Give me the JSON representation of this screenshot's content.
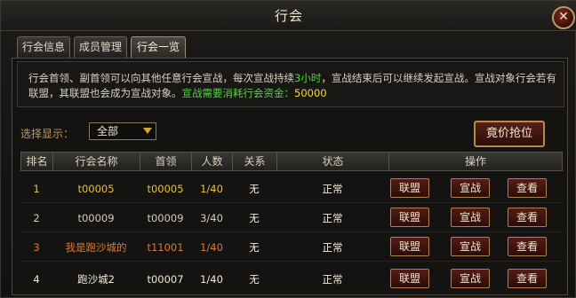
{
  "window": {
    "title": "行会",
    "close_label": "✕"
  },
  "tabs": [
    {
      "label": "行会信息",
      "active": false
    },
    {
      "label": "成员管理",
      "active": false
    },
    {
      "label": "行会一览",
      "active": true
    }
  ],
  "notice": {
    "part1": "行会首领、副首领可以向其他任意行会宣战，每次宣战持续",
    "duration": "3小时",
    "part2": "，宣战结束后可以继续发起宣战。宣战对象行会若有联盟，其联盟也会成为宣战对象。",
    "cost_label": "宣战需要消耗行会资金：",
    "cost_value": "50000"
  },
  "filter": {
    "label": "选择显示：",
    "selected": "全部"
  },
  "bid_button": "竟价抢位",
  "table": {
    "headers": [
      "排名",
      "行会名称",
      "首领",
      "人数",
      "关系",
      "状态",
      "操作"
    ],
    "rows": [
      {
        "rank": "1",
        "name": "t00005",
        "leader": "t00005",
        "count": "1/40",
        "relation": "无",
        "status": "正常",
        "rank_color": "#e8c430"
      },
      {
        "rank": "2",
        "name": "t00009",
        "leader": "t00009",
        "count": "3/40",
        "relation": "无",
        "status": "正常",
        "rank_color": "#d4cbb8"
      },
      {
        "rank": "3",
        "name": "我是跑沙城的",
        "leader": "t11001",
        "count": "1/40",
        "relation": "无",
        "status": "正常",
        "rank_color": "#e2782f"
      },
      {
        "rank": "4",
        "name": "跑沙城2",
        "leader": "t00007",
        "count": "1/40",
        "relation": "无",
        "status": "正常",
        "rank_color": "#d4cbb8"
      }
    ],
    "actions": [
      "联盟",
      "宣战",
      "查看"
    ]
  }
}
